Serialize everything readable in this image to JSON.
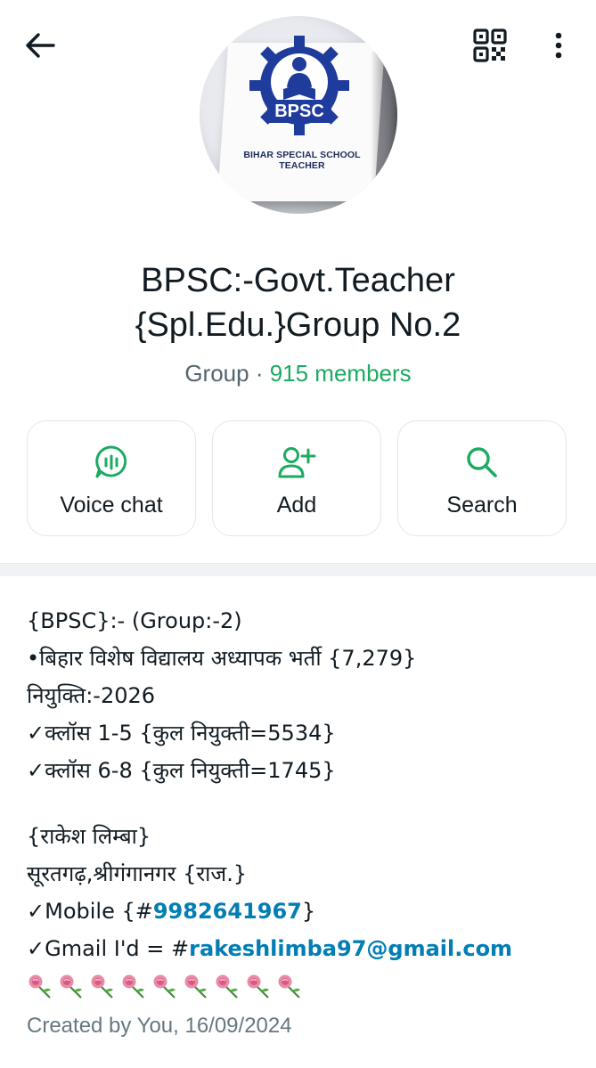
{
  "header": {
    "back_icon": "arrow-left-icon",
    "qr_icon": "qr-code-icon",
    "more_icon": "more-vertical-icon"
  },
  "avatar": {
    "logo_text": "BPSC",
    "caption": "BIHAR SPECIAL SCHOOL TEACHER"
  },
  "group": {
    "name_line1": "BPSC:-Govt.Teacher",
    "name_line2": "{Spl.Edu.}Group No.2",
    "type": "Group",
    "separator": " · ",
    "members": "915 members"
  },
  "actions": [
    {
      "label": "Voice chat",
      "icon": "voice-chat-icon"
    },
    {
      "label": "Add",
      "icon": "add-person-icon"
    },
    {
      "label": "Search",
      "icon": "search-icon"
    }
  ],
  "description": {
    "line1": "{BPSC}:- (Group:-2)",
    "line2": "•बिहार विशेष विद्यालय अध्यापक भर्ती {7,279}",
    "line3": "नियुक्ति:-2026",
    "line4": "✓क्लॉस 1-5 {कुल नियुक्ती=5534}",
    "line5": "✓क्लॉस 6-8 {कुल नियुक्ती=1745}",
    "line6": "{राकेश लिम्बा}",
    "line7": "सूरतगढ़,श्रीगंगानगर {राज.}",
    "mobile_prefix": "✓Mobile {#",
    "mobile_number": "9982641967",
    "mobile_suffix": "}",
    "gmail_prefix": "✓Gmail I'd = #",
    "gmail_address": "rakeshlimba97@gmail.com",
    "flower_count": 9
  },
  "footer": {
    "created": "Created by You, 16/09/2024"
  },
  "colors": {
    "accent_green": "#1daa61",
    "link_blue": "#027eb5",
    "bpsc_blue": "#1f3c9c"
  }
}
